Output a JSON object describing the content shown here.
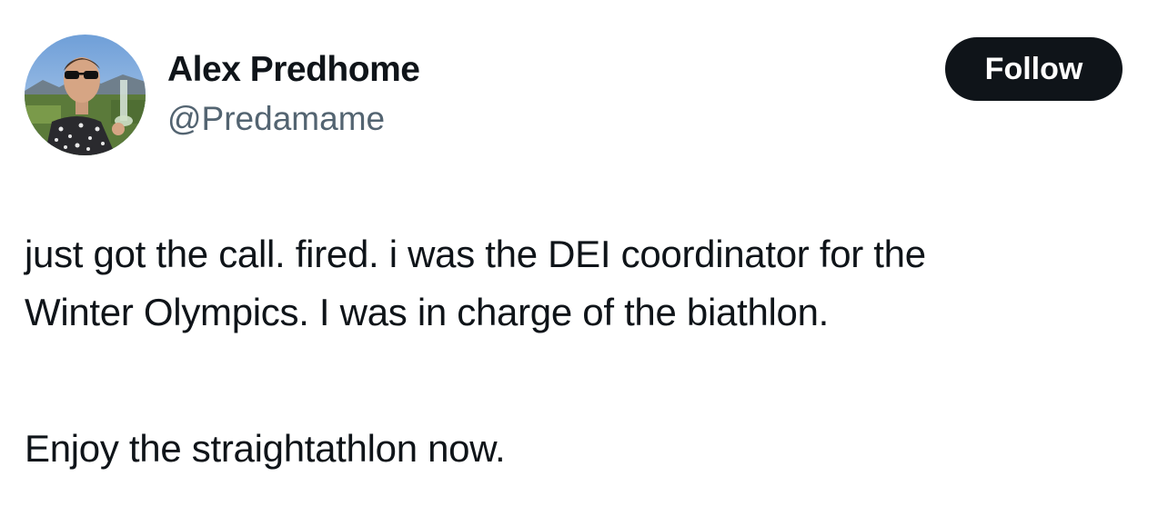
{
  "author": {
    "display_name": "Alex Predhome",
    "handle": "@Predamame"
  },
  "actions": {
    "follow_label": "Follow"
  },
  "tweet": {
    "lines": [
      "just got the call. fired. i was the DEI coordinator for the",
      "Winter Olympics. I was in charge of the biathlon.",
      "Enjoy the straightathlon now."
    ]
  },
  "colors": {
    "text": "#0f1419",
    "secondary": "#536471",
    "button_bg": "#0f1419",
    "button_text": "#ffffff"
  }
}
